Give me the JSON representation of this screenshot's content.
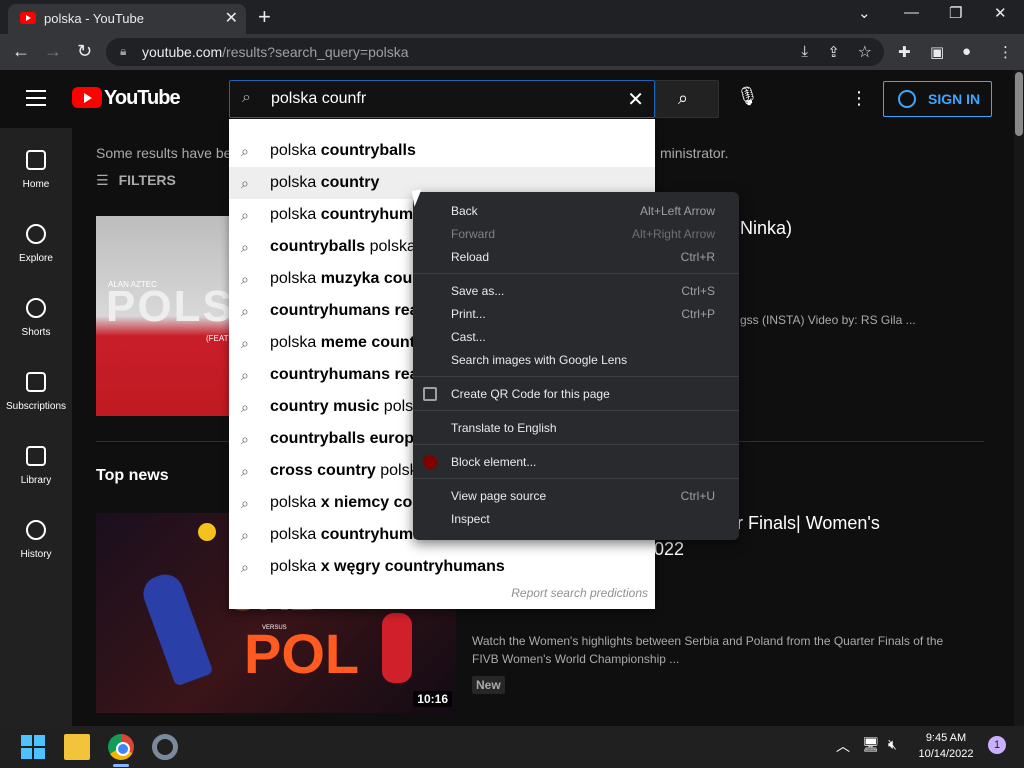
{
  "browser": {
    "tab_title": "polska - YouTube",
    "url_host": "youtube.com",
    "url_path": "/results?search_query=polska",
    "new_tab": "+",
    "tab_close": "✕"
  },
  "youtube": {
    "wordmark": "YouTube",
    "search_query": "polska counfr",
    "sign_in": "SIGN IN"
  },
  "sidebar": {
    "items": [
      {
        "label": "Home",
        "icon": "home-icon"
      },
      {
        "label": "Explore",
        "icon": "compass-icon"
      },
      {
        "label": "Shorts",
        "icon": "shorts-icon"
      },
      {
        "label": "Subscriptions",
        "icon": "subscriptions-icon"
      },
      {
        "label": "Library",
        "icon": "library-icon"
      },
      {
        "label": "History",
        "icon": "history-icon"
      }
    ]
  },
  "content": {
    "notice_left": "Some results have be",
    "notice_right": "ministrator.",
    "filters": "FILTERS",
    "video1": {
      "thumb_big": "POLS",
      "thumb_small": "ALAN AZTEC",
      "thumb_feat": "(FEAT",
      "title": "Ninka)",
      "desc": "gss (INSTA) Video by: RS Gila ..."
    },
    "top_news": "Top news",
    "video2": {
      "thumb_top": "SRB",
      "thumb_versus": "VERSUS",
      "thumb_bottom": "POL",
      "duration": "10:16",
      "title_line1": "rter Finals| Women's",
      "title_line2": "022",
      "desc": "Watch the Women's highlights between Serbia and Poland from the Quarter Finals of the FIVB Women's World Championship ...",
      "badge": "New"
    }
  },
  "suggestions": {
    "items": [
      {
        "plain": "polska ",
        "bold": "countryballs"
      },
      {
        "plain": "polska ",
        "bold": "country"
      },
      {
        "plain": "polska ",
        "bold": "countryhuma"
      },
      {
        "bold": "countryballs",
        "plain": " polska"
      },
      {
        "plain": "polska ",
        "bold": "muzyka coun"
      },
      {
        "bold": "countryhumans reac",
        "plain": ""
      },
      {
        "plain": "polska ",
        "bold": "meme countr"
      },
      {
        "bold": "countryhumans reac",
        "plain": ""
      },
      {
        "bold": "country music",
        "plain": " polsk"
      },
      {
        "bold": "countryballs europe",
        "plain": ""
      },
      {
        "bold": "cross country",
        "plain": " polska"
      },
      {
        "plain": "polska ",
        "bold": "x niemcy cou"
      },
      {
        "plain": "polska ",
        "bold": "countryhuma"
      },
      {
        "plain": "polska ",
        "bold": "x węgry countryhumans"
      }
    ],
    "report": "Report search predictions"
  },
  "context_menu": {
    "groups": [
      [
        {
          "label": "Back",
          "shortcut": "Alt+Left Arrow"
        },
        {
          "label": "Forward",
          "shortcut": "Alt+Right Arrow",
          "disabled": true
        },
        {
          "label": "Reload",
          "shortcut": "Ctrl+R"
        }
      ],
      [
        {
          "label": "Save as...",
          "shortcut": "Ctrl+S"
        },
        {
          "label": "Print...",
          "shortcut": "Ctrl+P"
        },
        {
          "label": "Cast...",
          "shortcut": ""
        },
        {
          "label": "Search images with Google Lens",
          "shortcut": ""
        }
      ],
      [
        {
          "label": "Create QR Code for this page",
          "shortcut": "",
          "icon": "qr-code-icon"
        }
      ],
      [
        {
          "label": "Translate to English",
          "shortcut": ""
        }
      ],
      [
        {
          "label": "Block element...",
          "shortcut": "",
          "icon": "ublock-icon"
        }
      ],
      [
        {
          "label": "View page source",
          "shortcut": "Ctrl+U"
        },
        {
          "label": "Inspect",
          "shortcut": ""
        }
      ]
    ]
  },
  "taskbar": {
    "time": "9:45 AM",
    "date": "10/14/2022",
    "notification_count": "1"
  },
  "colors": {
    "accent_blue": "#3ea6ff",
    "youtube_red": "#ff0000",
    "search_border": "#1c62b9"
  }
}
